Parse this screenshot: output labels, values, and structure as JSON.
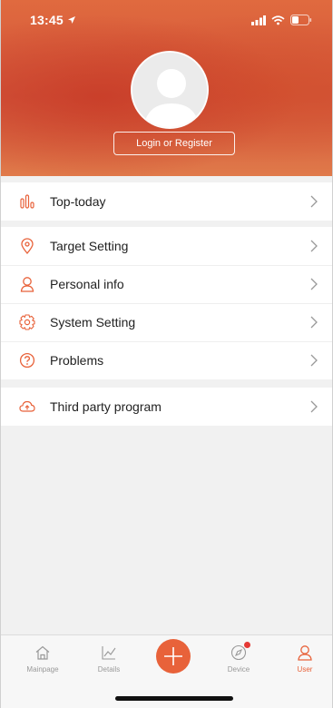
{
  "status_bar": {
    "time": "13:45"
  },
  "header": {
    "login_label": "Login or Register"
  },
  "group1": [
    {
      "label": "Top-today",
      "icon": "bar-chart-icon"
    }
  ],
  "group2": [
    {
      "label": "Target Setting",
      "icon": "location-pin-icon"
    },
    {
      "label": "Personal info",
      "icon": "person-icon"
    },
    {
      "label": "System Setting",
      "icon": "gear-icon"
    },
    {
      "label": "Problems",
      "icon": "question-icon"
    }
  ],
  "group3": [
    {
      "label": "Third party program",
      "icon": "cloud-upload-icon"
    }
  ],
  "tabbar": {
    "items": [
      {
        "label": "Mainpage",
        "icon": "home-icon"
      },
      {
        "label": "Details",
        "icon": "line-chart-icon"
      },
      {
        "label": "Device",
        "icon": "compass-icon"
      },
      {
        "label": "User",
        "icon": "user-icon"
      }
    ],
    "active": "User"
  },
  "colors": {
    "accent": "#e8623a",
    "header": "#d9573b",
    "badge": "#e53935"
  }
}
